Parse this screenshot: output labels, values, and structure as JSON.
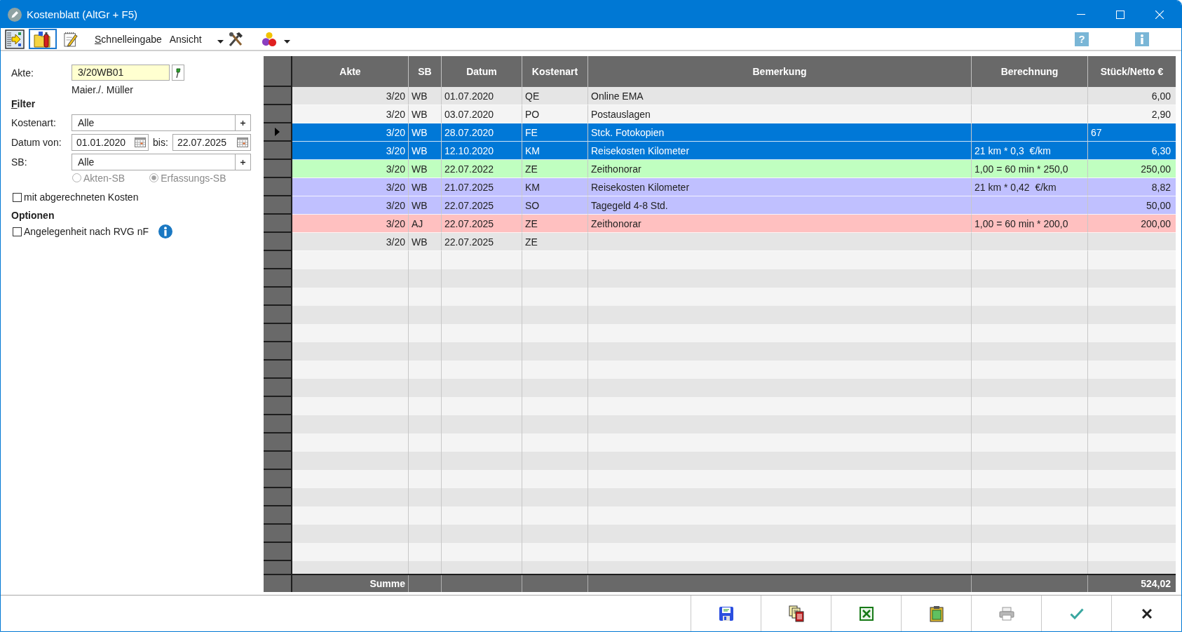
{
  "window": {
    "title": "Kostenblatt (AltGr + F5)"
  },
  "toolbar": {
    "icon_buttons": [
      {
        "selected": false
      },
      {
        "selected": true
      },
      {
        "selected": false
      }
    ],
    "menus": [
      "Schnelleingabe",
      "Ansicht"
    ],
    "help": "?"
  },
  "file": {
    "label": "Akte:",
    "value": "3/20WB01",
    "parties": "Maier./. Müller"
  },
  "filter": {
    "heading": "Filter",
    "kostenart": {
      "label": "Kostenart:",
      "value": "Alle"
    },
    "date": {
      "label": "Datum von:",
      "from": "01.01.2020",
      "to_label": "bis:",
      "to": "22.07.2025"
    },
    "sb": {
      "label": "SB:",
      "value": "Alle"
    },
    "sb_source": [
      {
        "label": "Akten-SB",
        "selected": false,
        "disabled": true
      },
      {
        "label": "Erfassungs-SB",
        "selected": true,
        "disabled": true
      }
    ],
    "include_billed": {
      "label": "mit abgerechneten Kosten",
      "checked": false
    }
  },
  "options": {
    "heading": "Optionen",
    "items": [
      {
        "label": "Angelegenheit nach RVG nF",
        "checked": false
      }
    ]
  },
  "table": {
    "columns": [
      "Akte",
      "SB",
      "Datum",
      "Kostenart",
      "Bemerkung",
      "Berechnung",
      "Stück/Netto €"
    ],
    "rows": [
      {
        "akte": "3/20",
        "sb": "WB",
        "datum": "01.07.2020",
        "kostenart": "QE",
        "bemerkung": "Online EMA",
        "stueck_netto": {
          "kind": "number",
          "text": "6,00"
        },
        "selected": false,
        "current": false
      },
      {
        "akte": "3/20",
        "sb": "WB",
        "datum": "03.07.2020",
        "kostenart": "PO",
        "bemerkung": "Postauslagen",
        "stueck_netto": {
          "kind": "number",
          "text": "2,90"
        },
        "selected": false,
        "current": false
      },
      {
        "akte": "3/20",
        "sb": "WB",
        "datum": "28.07.2020",
        "kostenart": "FE",
        "bemerkung": "Stck. Fotokopien",
        "stueck_netto": {
          "kind": "editor",
          "text": "67"
        },
        "selected": true,
        "current": true
      },
      {
        "akte": "3/20",
        "sb": "WB",
        "datum": "12.10.2020",
        "kostenart": "KM",
        "bemerkung": "Reisekosten Kilometer",
        "berechnung": "21 km * 0,3  €/km",
        "stueck_netto": {
          "kind": "number",
          "text": "6,30"
        },
        "selected": true,
        "current": false
      },
      {
        "akte": "3/20",
        "sb": "WB",
        "datum": "22.07.2022",
        "kostenart": "ZE",
        "bemerkung": "Zeithonorar",
        "berechnung": "1,00 = 60 min * 250,0",
        "stueck_netto": {
          "kind": "number",
          "text": "250,00"
        },
        "selected": false,
        "current": false,
        "color": "#c0ffc0"
      },
      {
        "akte": "3/20",
        "sb": "WB",
        "datum": "21.07.2025",
        "kostenart": "KM",
        "bemerkung": "Reisekosten Kilometer",
        "berechnung": "21 km * 0,42  €/km",
        "stueck_netto": {
          "kind": "number",
          "text": "8,82"
        },
        "selected": false,
        "current": false,
        "color": "#c0c0ff"
      },
      {
        "akte": "3/20",
        "sb": "WB",
        "datum": "22.07.2025",
        "kostenart": "SO",
        "bemerkung": "Tagegeld 4-8 Std.",
        "stueck_netto": {
          "kind": "number",
          "text": "50,00"
        },
        "selected": false,
        "current": false,
        "color": "#c0c0ff"
      },
      {
        "akte": "3/20",
        "sb": "AJ",
        "datum": "22.07.2025",
        "kostenart": "ZE",
        "bemerkung": "Zeithonorar",
        "berechnung": "1,00 = 60 min * 200,0",
        "stueck_netto": {
          "kind": "number",
          "text": "200,00"
        },
        "selected": false,
        "current": false,
        "color": "#ffc0c0"
      },
      {
        "akte": "3/20",
        "sb": "WB",
        "datum": "22.07.2025",
        "kostenart": "ZE",
        "selected": false,
        "current": false
      }
    ],
    "summary": {
      "label": "Summe",
      "total": "524,02"
    }
  }
}
